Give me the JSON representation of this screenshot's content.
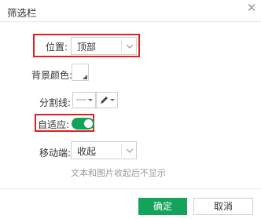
{
  "dialog": {
    "title": "筛选栏",
    "close_icon": "close-icon"
  },
  "position": {
    "label": "位置:",
    "value": "顶部"
  },
  "background_color": {
    "label": "背景颜色:"
  },
  "divider": {
    "label": "分割线:"
  },
  "adaptive": {
    "label": "自适应:",
    "enabled": true
  },
  "mobile": {
    "label": "移动端:",
    "value": "收起",
    "hint": "文本和图片收起后不显示"
  },
  "footer": {
    "ok_label": "确定",
    "cancel_label": "取消"
  },
  "colors": {
    "accent": "#14a35b",
    "highlight": "#e02020"
  }
}
